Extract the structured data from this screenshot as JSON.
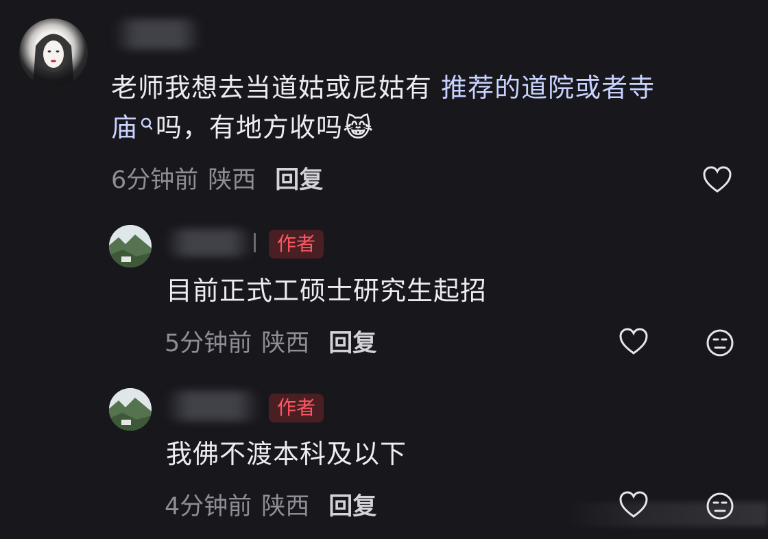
{
  "comment": {
    "text_line1_plain": "老师我想去当道姑或尼姑有 ",
    "text_line1_link": "推荐的道院或者寺",
    "text_line2_link": "庙",
    "text_line2_plain": "吗，有地方收吗",
    "emoji": "😹",
    "time": "6分钟前",
    "location": "陕西",
    "reply_label": "回复"
  },
  "replies": [
    {
      "author_tag": "作者",
      "text": "目前正式工硕士研究生起招",
      "time": "5分钟前",
      "location": "陕西",
      "reply_label": "回复"
    },
    {
      "author_tag": "作者",
      "text": "我佛不渡本科及以下",
      "time": "4分钟前",
      "location": "陕西",
      "reply_label": "回复"
    }
  ],
  "icons": {
    "like": "heart-icon",
    "dislike": "neutral-face-icon",
    "search_hint": "search-icon"
  },
  "colors": {
    "background": "#17171c",
    "author_tag_text": "#ff5763",
    "author_tag_bg": "#4a1f24",
    "link_text": "#c9d3ff"
  }
}
